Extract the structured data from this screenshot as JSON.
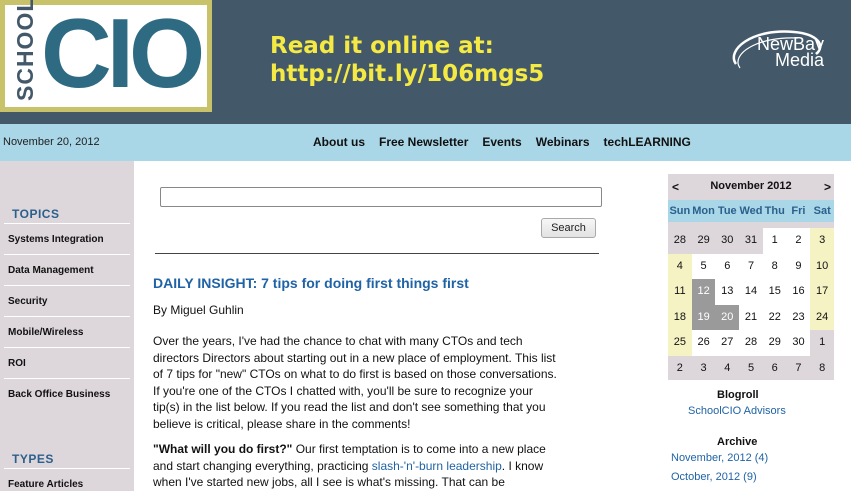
{
  "header": {
    "logo_school": "SCHOOL",
    "logo_cio": "CIO",
    "promo_line1": "Read it online at:",
    "promo_line2": "http://bit.ly/106mgs5",
    "publisher_line1": "NewBay",
    "publisher_line2": "Media"
  },
  "nav": {
    "date": "November 20, 2012",
    "links": [
      "About us",
      "Free Newsletter",
      "Events",
      "Webinars",
      "techLEARNING"
    ]
  },
  "sidebar": {
    "topics_heading": "TOPICS",
    "topics": [
      "Systems Integration",
      "Data Management",
      "Security",
      "Mobile/Wireless",
      "ROI",
      "Back Office Business"
    ],
    "types_heading": "TYPES",
    "types": [
      "Feature Articles"
    ]
  },
  "search": {
    "value": "",
    "button_label": "Search"
  },
  "article": {
    "title": "DAILY INSIGHT: 7 tips for doing first things first",
    "byline": "By Miguel Guhlin",
    "para1_lines": [
      "Over the years, I've had the chance to chat with many CTOs and tech",
      "directors Directors about starting out in a new place of employment. This list",
      "of 7 tips for \"new\" CTOs on what to do first is based on those conversations.",
      "If you're one of the CTOs I chatted with, you'll be sure to recognize your",
      "tip(s) in the list below. If you read the list and don't see something that you",
      "believe is critical, please share in the comments!"
    ],
    "para2_bold": "\"What will you do first?\"",
    "para2_line1_rest": " Our first temptation is to come into a new place",
    "para2_line2_pre": "and start changing everything, practicing ",
    "para2_link": "slash-'n'-burn leadership",
    "para2_line2_post": ". I know",
    "para2_line3": "when I've started new jobs, all I see is what's missing. That can be"
  },
  "calendar": {
    "prev": "<",
    "next": ">",
    "title": "November 2012",
    "days_of_week": [
      "Sun",
      "Mon",
      "Tue",
      "Wed",
      "Thu",
      "Fri",
      "Sat"
    ],
    "weeks": [
      [
        {
          "d": "28",
          "s": "grey"
        },
        {
          "d": "29",
          "s": "grey"
        },
        {
          "d": "30",
          "s": "grey"
        },
        {
          "d": "31",
          "s": "grey"
        },
        {
          "d": "1",
          "s": "white"
        },
        {
          "d": "2",
          "s": "white"
        },
        {
          "d": "3",
          "s": "cream"
        }
      ],
      [
        {
          "d": "4",
          "s": "cream"
        },
        {
          "d": "5",
          "s": "white"
        },
        {
          "d": "6",
          "s": "white"
        },
        {
          "d": "7",
          "s": "white"
        },
        {
          "d": "8",
          "s": "white"
        },
        {
          "d": "9",
          "s": "white"
        },
        {
          "d": "10",
          "s": "cream"
        }
      ],
      [
        {
          "d": "11",
          "s": "cream"
        },
        {
          "d": "12",
          "s": "hl"
        },
        {
          "d": "13",
          "s": "white"
        },
        {
          "d": "14",
          "s": "white"
        },
        {
          "d": "15",
          "s": "white"
        },
        {
          "d": "16",
          "s": "white"
        },
        {
          "d": "17",
          "s": "cream"
        }
      ],
      [
        {
          "d": "18",
          "s": "cream"
        },
        {
          "d": "19",
          "s": "hl"
        },
        {
          "d": "20",
          "s": "hl"
        },
        {
          "d": "21",
          "s": "white"
        },
        {
          "d": "22",
          "s": "white"
        },
        {
          "d": "23",
          "s": "white"
        },
        {
          "d": "24",
          "s": "cream"
        }
      ],
      [
        {
          "d": "25",
          "s": "cream"
        },
        {
          "d": "26",
          "s": "white"
        },
        {
          "d": "27",
          "s": "white"
        },
        {
          "d": "28",
          "s": "white"
        },
        {
          "d": "29",
          "s": "white"
        },
        {
          "d": "30",
          "s": "white"
        },
        {
          "d": "1",
          "s": "grey"
        }
      ],
      [
        {
          "d": "2",
          "s": "grey"
        },
        {
          "d": "3",
          "s": "grey"
        },
        {
          "d": "4",
          "s": "grey"
        },
        {
          "d": "5",
          "s": "grey"
        },
        {
          "d": "6",
          "s": "grey"
        },
        {
          "d": "7",
          "s": "grey"
        },
        {
          "d": "8",
          "s": "grey"
        }
      ]
    ]
  },
  "blogroll": {
    "title": "Blogroll",
    "link": "SchoolCIO Advisors"
  },
  "archive": {
    "title": "Archive",
    "links": [
      "November, 2012 (4)",
      "October, 2012 (9)"
    ]
  },
  "colors": {
    "header_bg": "#43596a",
    "nav_bg": "#a9d7e8",
    "sidebar_bg": "#ddd7dc",
    "promo_text": "#f5e944",
    "link": "#1f63a6"
  }
}
